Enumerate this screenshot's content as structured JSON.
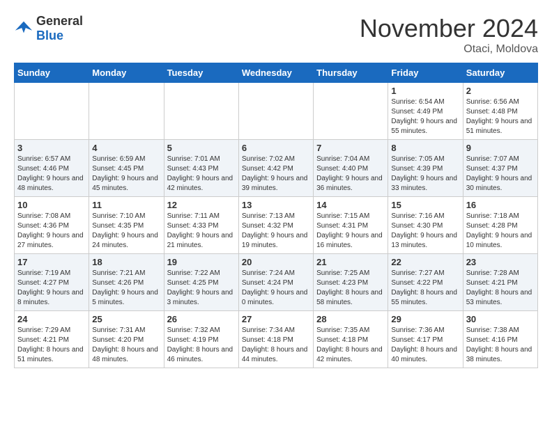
{
  "header": {
    "logo": {
      "general": "General",
      "blue": "Blue"
    },
    "title": "November 2024",
    "location": "Otaci, Moldova"
  },
  "calendar": {
    "days_of_week": [
      "Sunday",
      "Monday",
      "Tuesday",
      "Wednesday",
      "Thursday",
      "Friday",
      "Saturday"
    ],
    "weeks": [
      [
        {
          "day": "",
          "info": ""
        },
        {
          "day": "",
          "info": ""
        },
        {
          "day": "",
          "info": ""
        },
        {
          "day": "",
          "info": ""
        },
        {
          "day": "",
          "info": ""
        },
        {
          "day": "1",
          "info": "Sunrise: 6:54 AM\nSunset: 4:49 PM\nDaylight: 9 hours and 55 minutes."
        },
        {
          "day": "2",
          "info": "Sunrise: 6:56 AM\nSunset: 4:48 PM\nDaylight: 9 hours and 51 minutes."
        }
      ],
      [
        {
          "day": "3",
          "info": "Sunrise: 6:57 AM\nSunset: 4:46 PM\nDaylight: 9 hours and 48 minutes."
        },
        {
          "day": "4",
          "info": "Sunrise: 6:59 AM\nSunset: 4:45 PM\nDaylight: 9 hours and 45 minutes."
        },
        {
          "day": "5",
          "info": "Sunrise: 7:01 AM\nSunset: 4:43 PM\nDaylight: 9 hours and 42 minutes."
        },
        {
          "day": "6",
          "info": "Sunrise: 7:02 AM\nSunset: 4:42 PM\nDaylight: 9 hours and 39 minutes."
        },
        {
          "day": "7",
          "info": "Sunrise: 7:04 AM\nSunset: 4:40 PM\nDaylight: 9 hours and 36 minutes."
        },
        {
          "day": "8",
          "info": "Sunrise: 7:05 AM\nSunset: 4:39 PM\nDaylight: 9 hours and 33 minutes."
        },
        {
          "day": "9",
          "info": "Sunrise: 7:07 AM\nSunset: 4:37 PM\nDaylight: 9 hours and 30 minutes."
        }
      ],
      [
        {
          "day": "10",
          "info": "Sunrise: 7:08 AM\nSunset: 4:36 PM\nDaylight: 9 hours and 27 minutes."
        },
        {
          "day": "11",
          "info": "Sunrise: 7:10 AM\nSunset: 4:35 PM\nDaylight: 9 hours and 24 minutes."
        },
        {
          "day": "12",
          "info": "Sunrise: 7:11 AM\nSunset: 4:33 PM\nDaylight: 9 hours and 21 minutes."
        },
        {
          "day": "13",
          "info": "Sunrise: 7:13 AM\nSunset: 4:32 PM\nDaylight: 9 hours and 19 minutes."
        },
        {
          "day": "14",
          "info": "Sunrise: 7:15 AM\nSunset: 4:31 PM\nDaylight: 9 hours and 16 minutes."
        },
        {
          "day": "15",
          "info": "Sunrise: 7:16 AM\nSunset: 4:30 PM\nDaylight: 9 hours and 13 minutes."
        },
        {
          "day": "16",
          "info": "Sunrise: 7:18 AM\nSunset: 4:28 PM\nDaylight: 9 hours and 10 minutes."
        }
      ],
      [
        {
          "day": "17",
          "info": "Sunrise: 7:19 AM\nSunset: 4:27 PM\nDaylight: 9 hours and 8 minutes."
        },
        {
          "day": "18",
          "info": "Sunrise: 7:21 AM\nSunset: 4:26 PM\nDaylight: 9 hours and 5 minutes."
        },
        {
          "day": "19",
          "info": "Sunrise: 7:22 AM\nSunset: 4:25 PM\nDaylight: 9 hours and 3 minutes."
        },
        {
          "day": "20",
          "info": "Sunrise: 7:24 AM\nSunset: 4:24 PM\nDaylight: 9 hours and 0 minutes."
        },
        {
          "day": "21",
          "info": "Sunrise: 7:25 AM\nSunset: 4:23 PM\nDaylight: 8 hours and 58 minutes."
        },
        {
          "day": "22",
          "info": "Sunrise: 7:27 AM\nSunset: 4:22 PM\nDaylight: 8 hours and 55 minutes."
        },
        {
          "day": "23",
          "info": "Sunrise: 7:28 AM\nSunset: 4:21 PM\nDaylight: 8 hours and 53 minutes."
        }
      ],
      [
        {
          "day": "24",
          "info": "Sunrise: 7:29 AM\nSunset: 4:21 PM\nDaylight: 8 hours and 51 minutes."
        },
        {
          "day": "25",
          "info": "Sunrise: 7:31 AM\nSunset: 4:20 PM\nDaylight: 8 hours and 48 minutes."
        },
        {
          "day": "26",
          "info": "Sunrise: 7:32 AM\nSunset: 4:19 PM\nDaylight: 8 hours and 46 minutes."
        },
        {
          "day": "27",
          "info": "Sunrise: 7:34 AM\nSunset: 4:18 PM\nDaylight: 8 hours and 44 minutes."
        },
        {
          "day": "28",
          "info": "Sunrise: 7:35 AM\nSunset: 4:18 PM\nDaylight: 8 hours and 42 minutes."
        },
        {
          "day": "29",
          "info": "Sunrise: 7:36 AM\nSunset: 4:17 PM\nDaylight: 8 hours and 40 minutes."
        },
        {
          "day": "30",
          "info": "Sunrise: 7:38 AM\nSunset: 4:16 PM\nDaylight: 8 hours and 38 minutes."
        }
      ]
    ]
  }
}
